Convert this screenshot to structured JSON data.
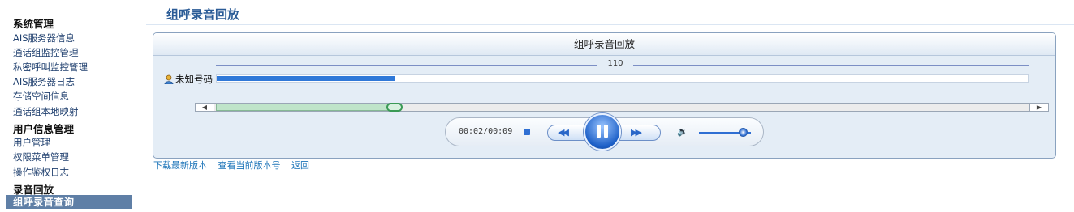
{
  "sidebar": {
    "groups": [
      "系统管理",
      "用户信息管理",
      "录音回放"
    ],
    "system_items": [
      "AIS服务器信息",
      "通话组监控管理",
      "私密呼叫监控管理",
      "AIS服务器日志",
      "存储空间信息",
      "通话组本地映射"
    ],
    "user_items": [
      "用户管理",
      "权限菜单管理",
      "操作鉴权日志"
    ],
    "active_item": "组呼录音查询"
  },
  "main": {
    "title": "组呼录音回放"
  },
  "player": {
    "header": "组呼录音回放",
    "scale_label": "110",
    "track_label": "未知号码",
    "progress_fraction": 0.22,
    "time": "00:02/00:09",
    "volume_fraction": 0.85,
    "scroll_left_glyph": "◀",
    "scroll_right_glyph": "▶",
    "rewind_glyph": "◀◀",
    "forward_glyph": "▶▶",
    "volume_glyph": "🔉"
  },
  "links": {
    "download": "下载最新版本",
    "version": "查看当前版本号",
    "back": "返回"
  },
  "colors": {
    "accent": "#2f78d8",
    "sidebar_active": "#5f7fa6",
    "title": "#2a5b96",
    "link": "#1a73b8",
    "playhead": "#e04848"
  }
}
